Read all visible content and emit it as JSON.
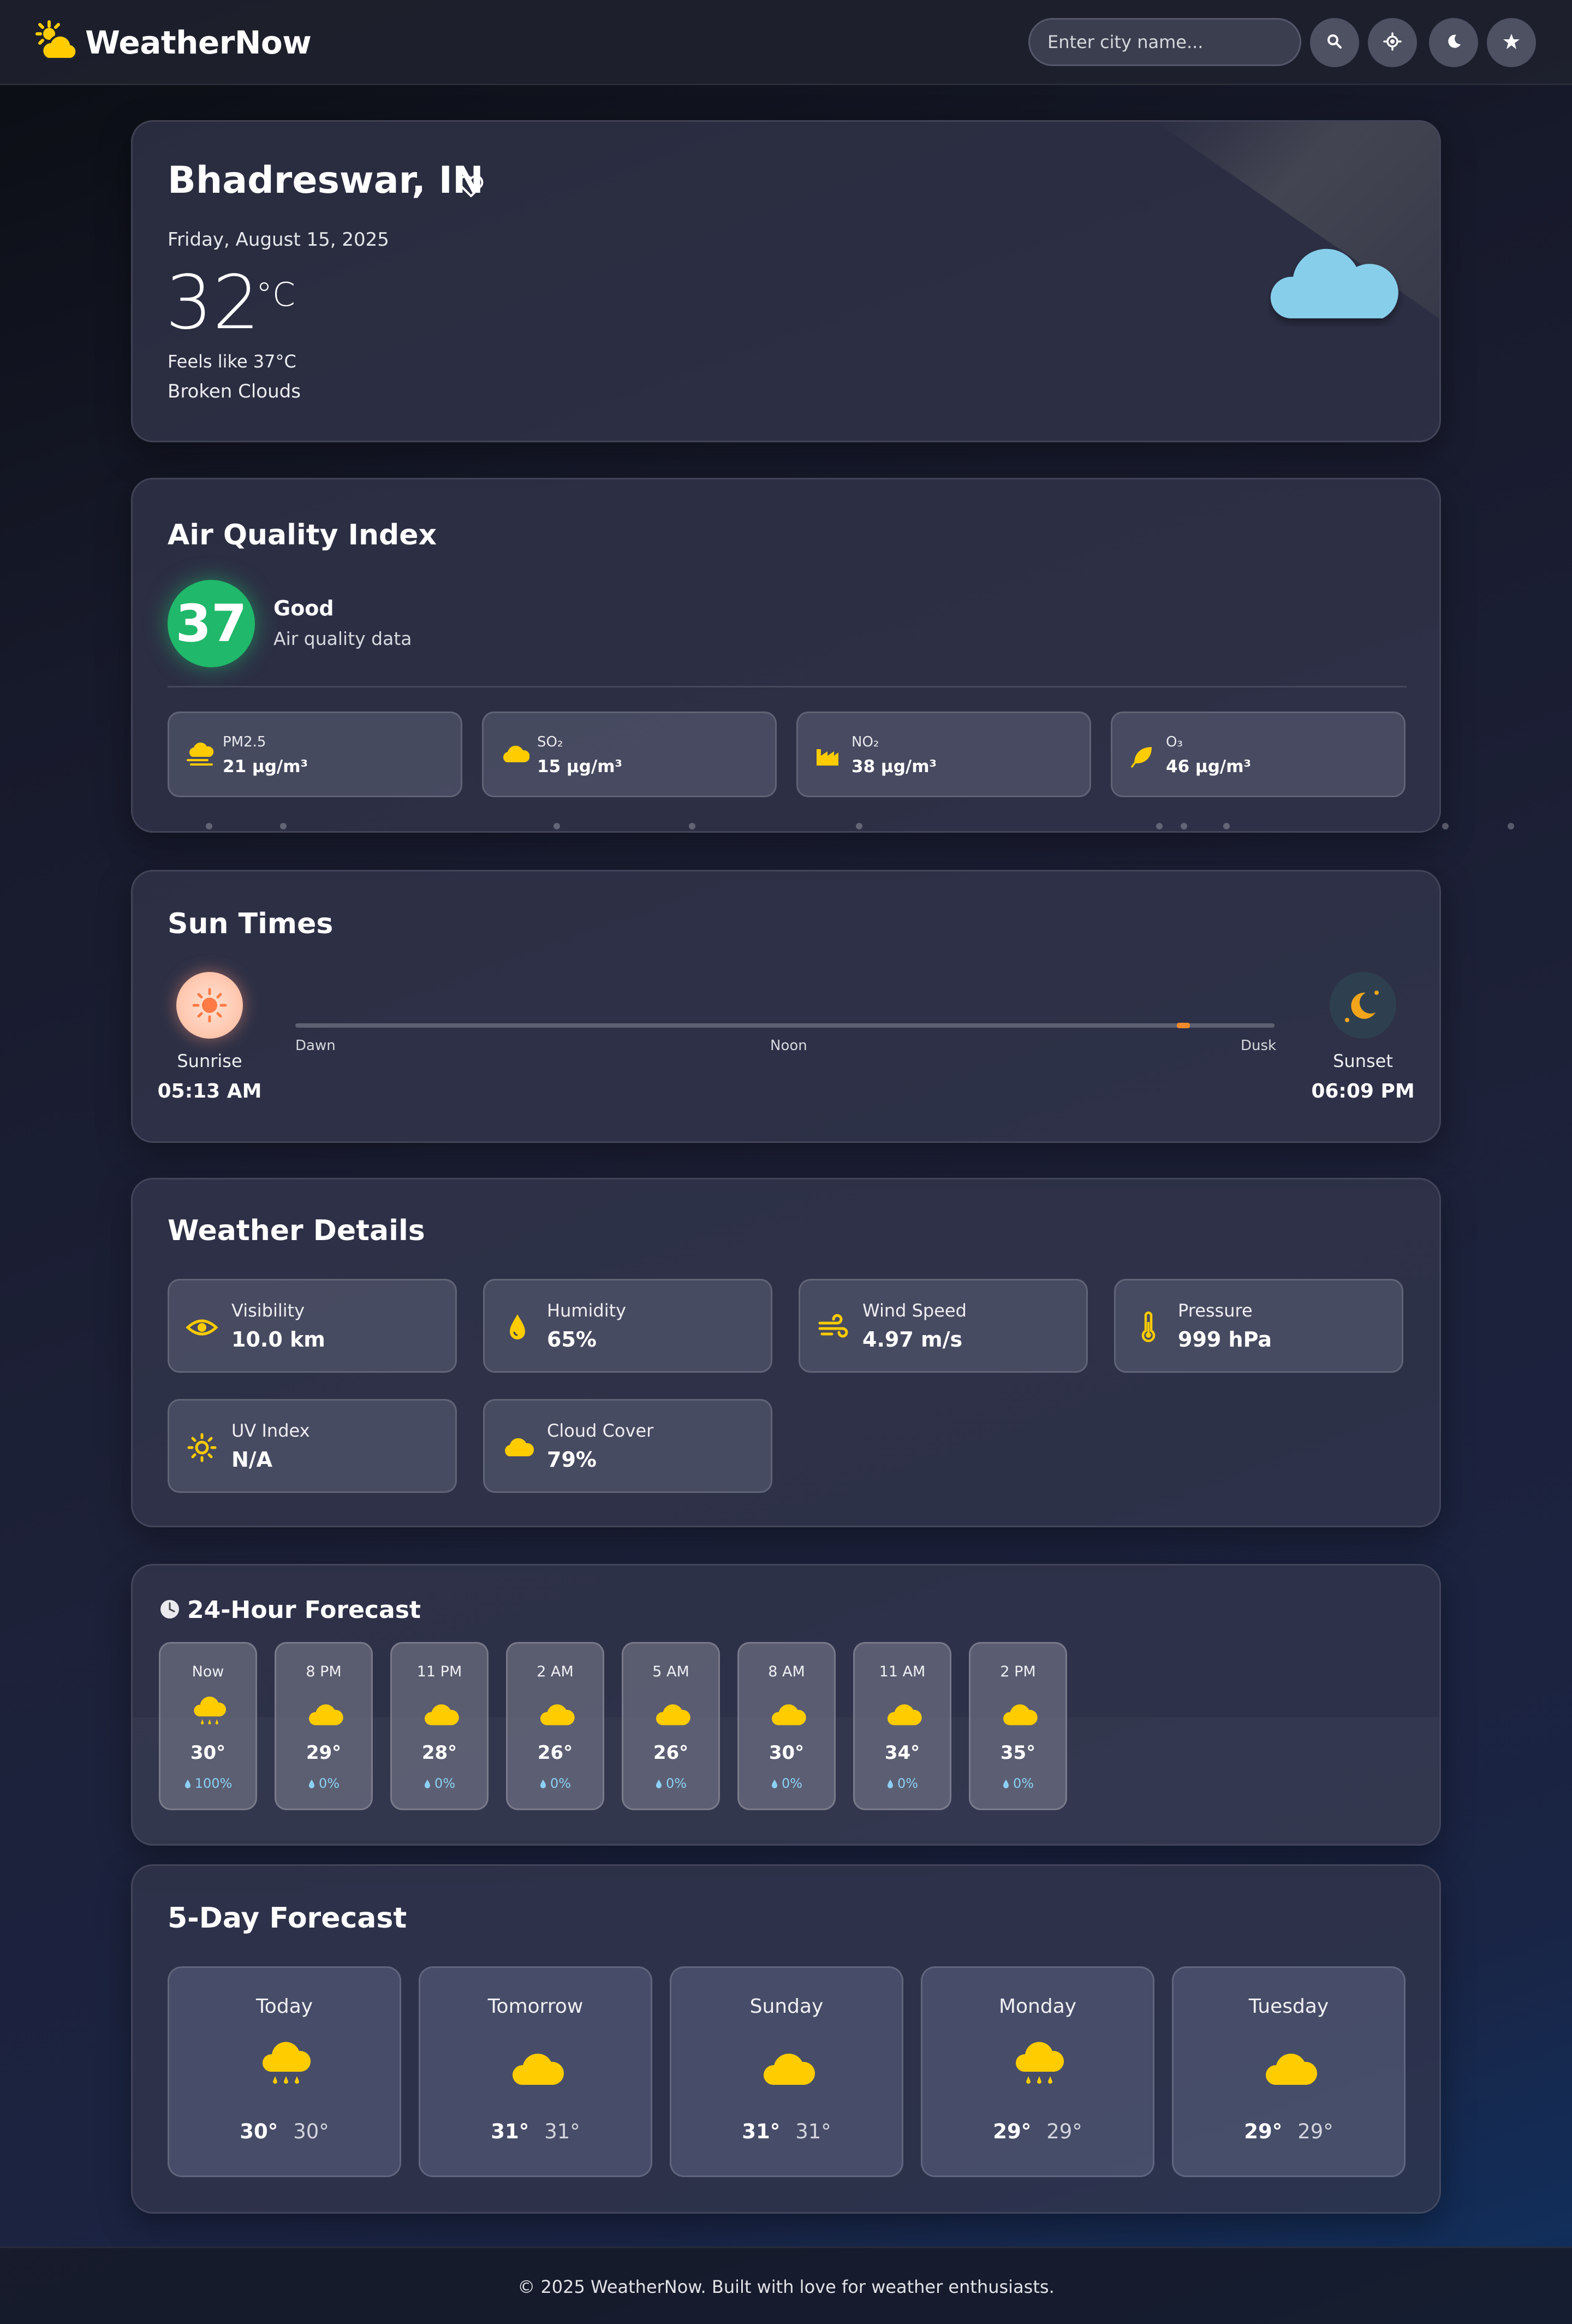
{
  "app": {
    "name": "WeatherNow"
  },
  "header": {
    "search_placeholder": "Enter city name...",
    "buttons": [
      "search-icon",
      "locate-icon",
      "moon-icon",
      "star-icon"
    ]
  },
  "current": {
    "city": "Bhadreswar, IN",
    "date": "Friday, August 15, 2025",
    "temp": "32",
    "unit": "°C",
    "feels_like": "Feels like 37°C",
    "description": "Broken Clouds",
    "icon": "cloud-icon"
  },
  "aqi": {
    "title": "Air Quality Index",
    "value": "37",
    "status": "Good",
    "subtitle": "Air quality data",
    "color": "#20b86a",
    "pollutants": [
      {
        "name": "PM2.5",
        "value": "21 μg/m³",
        "icon": "haze-icon"
      },
      {
        "name": "SO₂",
        "value": "15 μg/m³",
        "icon": "cloud-icon"
      },
      {
        "name": "NO₂",
        "value": "38 μg/m³",
        "icon": "factory-icon"
      },
      {
        "name": "O₃",
        "value": "46 μg/m³",
        "icon": "leaf-icon"
      }
    ]
  },
  "sun": {
    "title": "Sun Times",
    "sunrise_label": "Sunrise",
    "sunrise": "05:13 AM",
    "sunset_label": "Sunset",
    "sunset": "06:09 PM",
    "ticks": [
      "Dawn",
      "Noon",
      "Dusk"
    ],
    "progress": 0.9
  },
  "details": {
    "title": "Weather Details",
    "items": [
      {
        "label": "Visibility",
        "value": "10.0 km",
        "icon": "eye-icon"
      },
      {
        "label": "Humidity",
        "value": "65%",
        "icon": "droplet-icon"
      },
      {
        "label": "Wind Speed",
        "value": "4.97 m/s",
        "icon": "wind-icon"
      },
      {
        "label": "Pressure",
        "value": "999 hPa",
        "icon": "thermometer-icon"
      },
      {
        "label": "UV Index",
        "value": "N/A",
        "icon": "sun-icon"
      },
      {
        "label": "Cloud Cover",
        "value": "79%",
        "icon": "cloud-icon"
      }
    ]
  },
  "hourly": {
    "title": "24-Hour Forecast",
    "items": [
      {
        "time": "Now",
        "temp": "30°",
        "rain": "100%",
        "icon": "rain-cloud-icon"
      },
      {
        "time": "8 PM",
        "temp": "29°",
        "rain": "0%",
        "icon": "cloud-icon"
      },
      {
        "time": "11 PM",
        "temp": "28°",
        "rain": "0%",
        "icon": "cloud-icon"
      },
      {
        "time": "2 AM",
        "temp": "26°",
        "rain": "0%",
        "icon": "cloud-icon"
      },
      {
        "time": "5 AM",
        "temp": "26°",
        "rain": "0%",
        "icon": "cloud-icon"
      },
      {
        "time": "8 AM",
        "temp": "30°",
        "rain": "0%",
        "icon": "cloud-icon"
      },
      {
        "time": "11 AM",
        "temp": "34°",
        "rain": "0%",
        "icon": "cloud-icon"
      },
      {
        "time": "2 PM",
        "temp": "35°",
        "rain": "0%",
        "icon": "cloud-icon"
      }
    ]
  },
  "daily": {
    "title": "5-Day Forecast",
    "items": [
      {
        "day": "Today",
        "hi": "30°",
        "lo": "30°",
        "icon": "rain-cloud-icon"
      },
      {
        "day": "Tomorrow",
        "hi": "31°",
        "lo": "31°",
        "icon": "cloud-icon"
      },
      {
        "day": "Sunday",
        "hi": "31°",
        "lo": "31°",
        "icon": "cloud-icon"
      },
      {
        "day": "Monday",
        "hi": "29°",
        "lo": "29°",
        "icon": "rain-cloud-icon"
      },
      {
        "day": "Tuesday",
        "hi": "29°",
        "lo": "29°",
        "icon": "cloud-icon"
      }
    ]
  },
  "footer": {
    "text": "© 2025 WeatherNow. Built with love for weather enthusiasts."
  },
  "colors": {
    "accent": "#ffcc00",
    "sky_cloud": "#87ceeb",
    "rain": "#8cd1f5",
    "sunrise": "#ff8a5c",
    "moon": "#f2a51a"
  }
}
